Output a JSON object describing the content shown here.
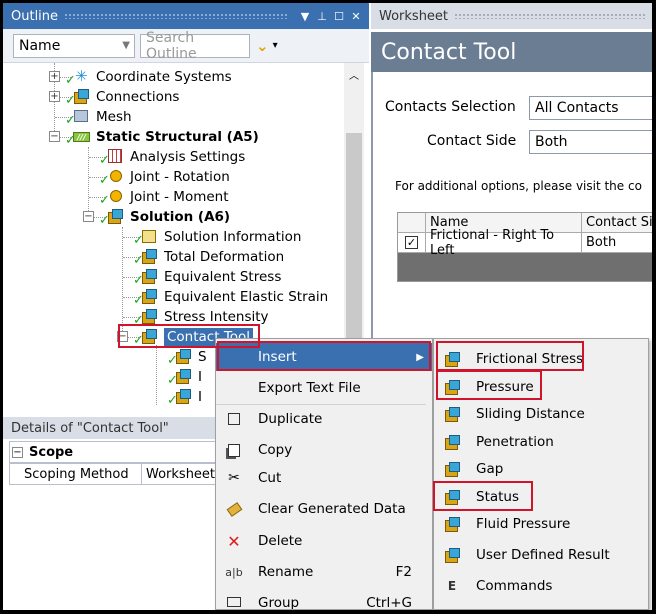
{
  "outline": {
    "title": "Outline",
    "controls": [
      "▼",
      "ᵩ",
      "☐",
      "✕"
    ],
    "name_combo": "Name",
    "search_placeholder": "Search Outline",
    "tree": [
      {
        "label": "Coordinate Systems",
        "bold": false
      },
      {
        "label": "Connections",
        "bold": false
      },
      {
        "label": "Mesh",
        "bold": false
      },
      {
        "label": "Static Structural (A5)",
        "bold": true
      },
      {
        "label": "Analysis Settings",
        "bold": false
      },
      {
        "label": "Joint - Rotation",
        "bold": false
      },
      {
        "label": "Joint - Moment",
        "bold": false
      },
      {
        "label": "Solution (A6)",
        "bold": true
      },
      {
        "label": "Solution Information",
        "bold": false
      },
      {
        "label": "Total Deformation",
        "bold": false
      },
      {
        "label": "Equivalent Stress",
        "bold": false
      },
      {
        "label": "Equivalent Elastic Strain",
        "bold": false
      },
      {
        "label": "Stress Intensity",
        "bold": false
      },
      {
        "label": "Contact Tool",
        "bold": false
      }
    ],
    "contact_children_partial": [
      "S",
      "I",
      "I"
    ]
  },
  "details": {
    "title": "Details of \"Contact Tool\"",
    "section": "Scope",
    "row_key": "Scoping Method",
    "row_value": "Worksheet"
  },
  "worksheet": {
    "tab": "Worksheet",
    "title": "Contact Tool",
    "contacts_selection_label": "Contacts Selection",
    "contacts_selection_value": "All Contacts",
    "contact_side_label": "Contact Side",
    "contact_side_value": "Both",
    "info_text": "For additional options, please visit the co",
    "table": {
      "headers": [
        "Name",
        "Contact Si"
      ],
      "rows": [
        {
          "checked": true,
          "name": "Frictional - Right To Left",
          "side": "Both"
        }
      ]
    }
  },
  "context_menu": {
    "items": [
      {
        "label": "Insert",
        "shortcut": "",
        "icon": "none",
        "highlighted": true
      },
      {
        "label": "Export Text File",
        "shortcut": "",
        "icon": "none"
      },
      {
        "label": "Duplicate",
        "shortcut": "",
        "icon": "duplicate-icon"
      },
      {
        "label": "Copy",
        "shortcut": "",
        "icon": "copy-icon"
      },
      {
        "label": "Cut",
        "shortcut": "",
        "icon": "scissors-icon"
      },
      {
        "label": "Clear Generated Data",
        "shortcut": "",
        "icon": "eraser-icon"
      },
      {
        "label": "Delete",
        "shortcut": "",
        "icon": "delete-x-icon"
      },
      {
        "label": "Rename",
        "shortcut": "F2",
        "icon": "rename-icon"
      },
      {
        "label": "Group",
        "shortcut": "Ctrl+G",
        "icon": "group-icon"
      }
    ]
  },
  "submenu": {
    "items": [
      {
        "label": "Frictional Stress",
        "highlighted": true
      },
      {
        "label": "Pressure",
        "highlighted": true
      },
      {
        "label": "Sliding Distance",
        "highlighted": false
      },
      {
        "label": "Penetration",
        "highlighted": false
      },
      {
        "label": "Gap",
        "highlighted": false
      },
      {
        "label": "Status",
        "highlighted": true
      },
      {
        "label": "Fluid Pressure",
        "highlighted": false
      },
      {
        "label": "User Defined Result",
        "highlighted": false
      },
      {
        "label": "Commands",
        "highlighted": false
      }
    ]
  },
  "colors": {
    "accent": "#3a6fb0",
    "highlight_box": "#d0142c",
    "check": "#1aa61a",
    "selection": "#3a6fb0"
  }
}
